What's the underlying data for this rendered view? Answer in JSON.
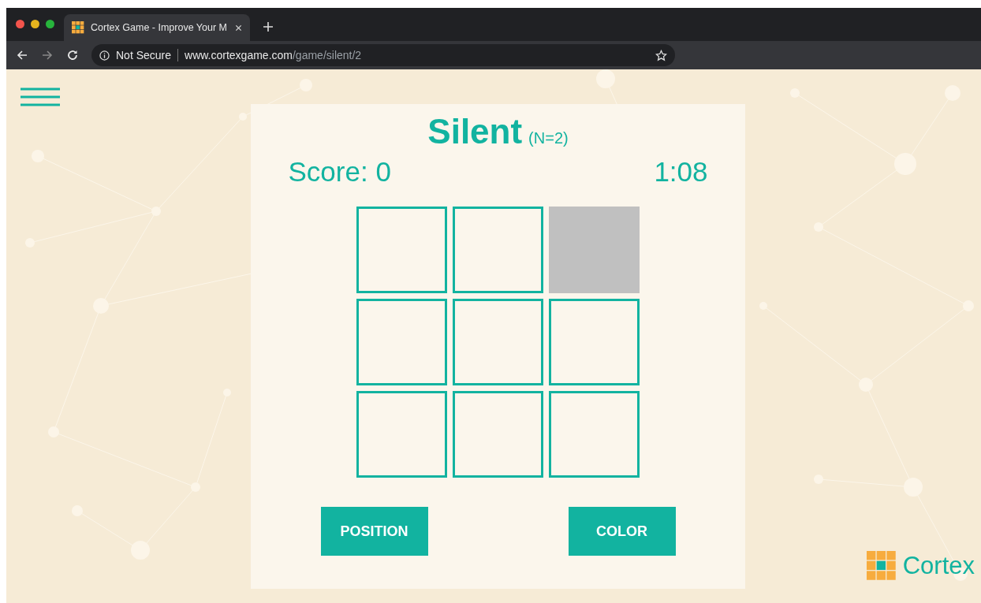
{
  "browser": {
    "tab": {
      "title": "Cortex Game - Improve Your M",
      "selected": true
    },
    "url_host": "www.cortexgame.com",
    "url_path": "/game/silent/2",
    "security": "Not Secure"
  },
  "game": {
    "title": "Silent",
    "subtitle": "(N=2)",
    "score": "Score: 0",
    "timer": "1:08",
    "cells": [
      {
        "active": false
      },
      {
        "active": false
      },
      {
        "active": true
      },
      {
        "active": false
      },
      {
        "active": false
      },
      {
        "active": false
      },
      {
        "active": false
      },
      {
        "active": false
      },
      {
        "active": false
      }
    ],
    "buttons": [
      "POSITION",
      "COLOR"
    ]
  },
  "logo": {
    "text": "Cortex"
  }
}
